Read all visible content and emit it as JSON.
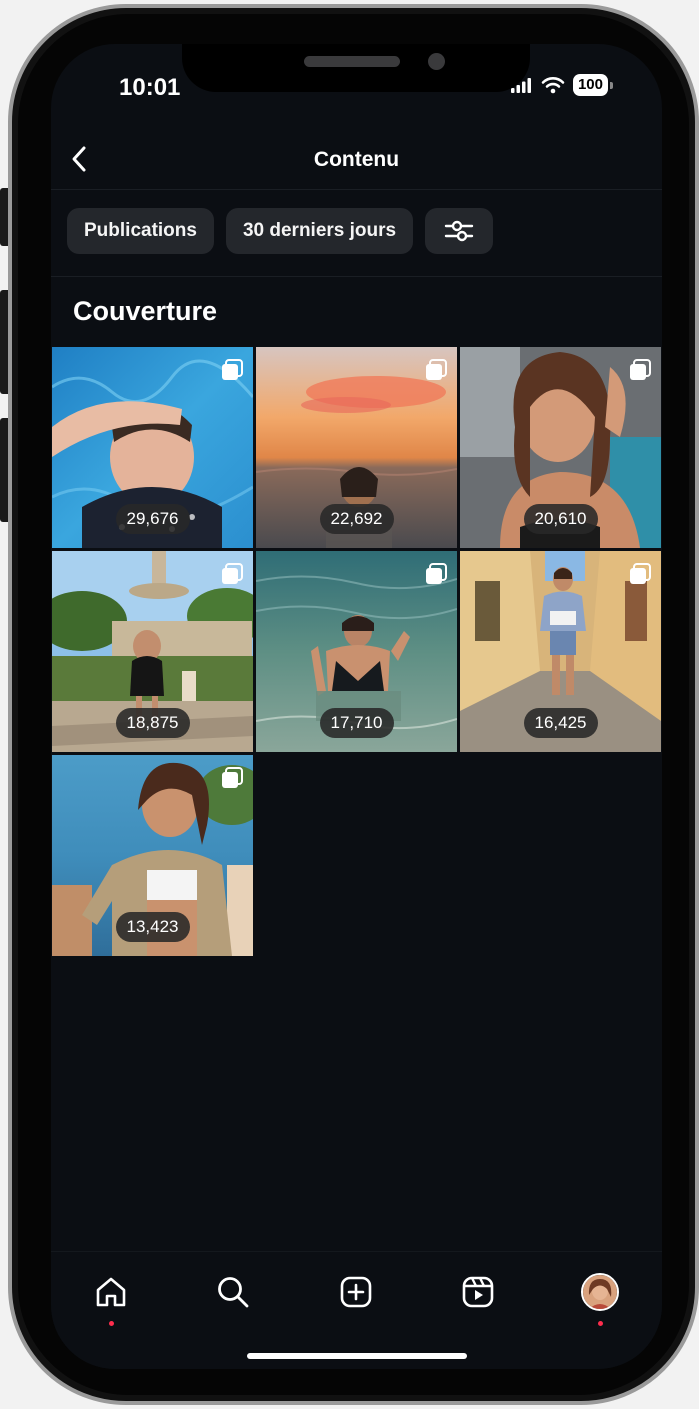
{
  "status_bar": {
    "time": "10:01",
    "battery": "100"
  },
  "header": {
    "title": "Contenu"
  },
  "filters": [
    {
      "label": "Publications"
    },
    {
      "label": "30 derniers jours"
    }
  ],
  "section": {
    "title": "Couverture"
  },
  "posts": [
    {
      "count": "29,676"
    },
    {
      "count": "22,692"
    },
    {
      "count": "20,610"
    },
    {
      "count": "18,875"
    },
    {
      "count": "17,710"
    },
    {
      "count": "16,425"
    },
    {
      "count": "13,423"
    }
  ],
  "tabbar": {
    "items": [
      "home-icon",
      "search-icon",
      "create-icon",
      "reels-icon",
      "profile-avatar"
    ]
  },
  "colors": {
    "background": "#0b0e13",
    "chip": "#24272c",
    "notification_dot": "#ff2d4d"
  }
}
